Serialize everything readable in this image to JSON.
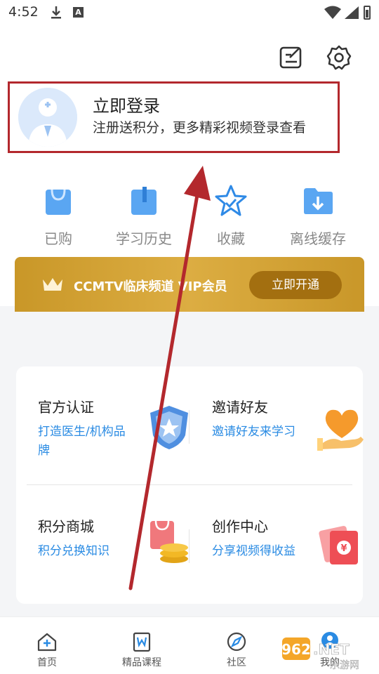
{
  "status_bar": {
    "time": "4:52",
    "icons": [
      "download-icon",
      "a-notification-icon",
      "wifi-icon",
      "signal-icon",
      "battery-icon"
    ]
  },
  "header": {
    "icons": [
      "edit-icon",
      "settings-icon"
    ]
  },
  "login": {
    "title": "立即登录",
    "subtitle": "注册送积分，更多精彩视频登录查看",
    "highlight_color": "#b3282d"
  },
  "quick_actions": [
    {
      "label": "已购",
      "icon": "shopping-bag-icon"
    },
    {
      "label": "学习历史",
      "icon": "book-icon"
    },
    {
      "label": "收藏",
      "icon": "star-icon"
    },
    {
      "label": "离线缓存",
      "icon": "download-folder-icon"
    }
  ],
  "vip": {
    "text": "CCMTV临床频道 VIP会员",
    "button": "立即开通",
    "color": "#d4a53a"
  },
  "features": [
    {
      "title": "官方认证",
      "desc": "打造医生/机构品牌",
      "icon": "certification-badge-icon"
    },
    {
      "title": "邀请好友",
      "desc": "邀请好友来学习",
      "icon": "heart-hand-icon"
    },
    {
      "title": "积分商城",
      "desc": "积分兑换知识",
      "icon": "coins-bag-icon"
    },
    {
      "title": "创作中心",
      "desc": "分享视频得收益",
      "icon": "red-envelope-icon"
    }
  ],
  "tabs": [
    {
      "label": "首页",
      "icon": "home-icon"
    },
    {
      "label": "精品课程",
      "icon": "course-icon"
    },
    {
      "label": "社区",
      "icon": "compass-icon"
    },
    {
      "label": "我的",
      "icon": "profile-icon"
    }
  ],
  "watermark": {
    "brand": "962.NET",
    "sub": "乐游网"
  },
  "accent_color": "#2a8be3"
}
